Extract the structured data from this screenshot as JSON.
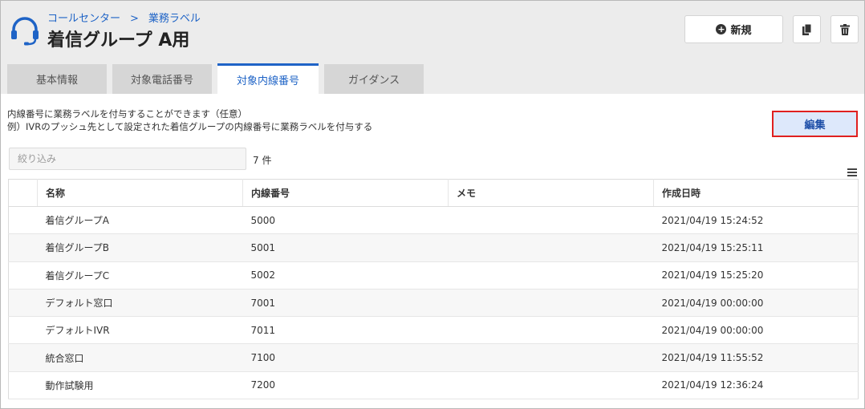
{
  "header": {
    "breadcrumb": [
      "コールセンター",
      ">",
      "業務ラベル"
    ],
    "title": "着信グループ A用",
    "new_label": "新規",
    "icons": [
      "headset-icon",
      "copy-icon",
      "trash-icon",
      "plus-circle-icon"
    ]
  },
  "tabs": [
    {
      "label": "基本情報",
      "active": false
    },
    {
      "label": "対象電話番号",
      "active": false
    },
    {
      "label": "対象内線番号",
      "active": true
    },
    {
      "label": "ガイダンス",
      "active": false
    }
  ],
  "content": {
    "desc_line1": "内線番号に業務ラベルを付与することができます（任意）",
    "desc_line2": "例）IVRのプッシュ先として設定された着信グループの内線番号に業務ラベルを付与する",
    "edit_label": "編集",
    "filter_placeholder": "絞り込み",
    "count": "7 件"
  },
  "table": {
    "columns": [
      "名称",
      "内線番号",
      "メモ",
      "作成日時"
    ],
    "rows": [
      {
        "name": "着信グループA",
        "ext": "5000",
        "memo": "",
        "created": "2021/04/19 15:24:52"
      },
      {
        "name": "着信グループB",
        "ext": "5001",
        "memo": "",
        "created": "2021/04/19 15:25:11"
      },
      {
        "name": "着信グループC",
        "ext": "5002",
        "memo": "",
        "created": "2021/04/19 15:25:20"
      },
      {
        "name": "デフォルト窓口",
        "ext": "7001",
        "memo": "",
        "created": "2021/04/19 00:00:00"
      },
      {
        "name": "デフォルトIVR",
        "ext": "7011",
        "memo": "",
        "created": "2021/04/19 00:00:00"
      },
      {
        "name": "統合窓口",
        "ext": "7100",
        "memo": "",
        "created": "2021/04/19 11:55:52"
      },
      {
        "name": "動作試験用",
        "ext": "7200",
        "memo": "",
        "created": "2021/04/19 12:36:24"
      }
    ]
  },
  "colors": {
    "accent": "#1e63c6",
    "highlight_border": "#e0201f"
  }
}
